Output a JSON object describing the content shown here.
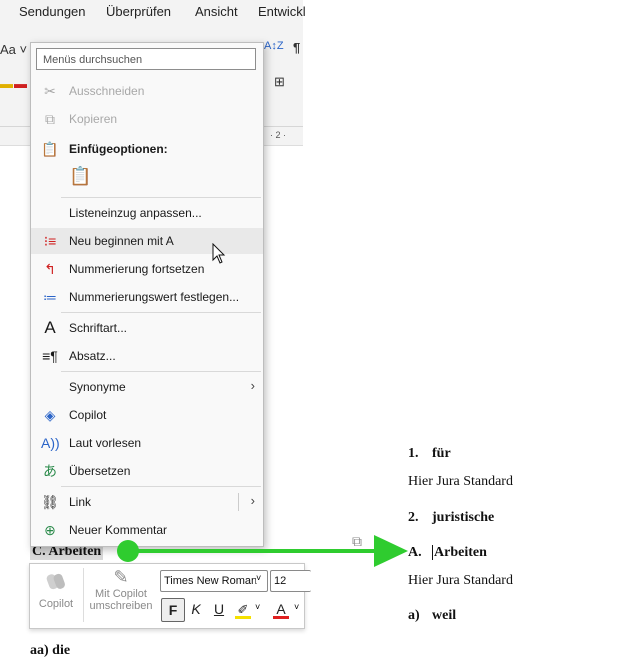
{
  "ribbon": {
    "tabs": [
      "Sendungen",
      "Überprüfen",
      "Ansicht",
      "Entwickl"
    ]
  },
  "document_left": {
    "heading": "C.  Arbeiten",
    "sub": "aa) die"
  },
  "context_menu": {
    "search_placeholder": "Menüs durchsuchen",
    "cut": "Ausschneiden",
    "copy": "Kopieren",
    "paste_header": "Einfügeoptionen:",
    "adjust_indent": "Listeneinzug anpassen...",
    "restart_at": "Neu beginnen mit A",
    "continue_numbering": "Nummerierung fortsetzen",
    "set_value": "Nummerierungswert festlegen...",
    "font": "Schriftart...",
    "paragraph": "Absatz...",
    "synonyms": "Synonyme",
    "copilot": "Copilot",
    "read_aloud": "Laut vorlesen",
    "translate": "Übersetzen",
    "link": "Link",
    "new_comment": "Neuer Kommentar"
  },
  "mini_toolbar": {
    "copilot": "Copilot",
    "rewrite_line1": "Mit Copilot",
    "rewrite_line2": "umschreiben",
    "font_name": "Times New Roman",
    "font_size": "12",
    "bold": "F",
    "italic": "K",
    "underline": "U",
    "highlight_color": "#f5e100",
    "font_color": "#e02020"
  },
  "arrow_color": "#2fcc2f",
  "document_right": {
    "item1_num": "1.",
    "item1_text": "für",
    "body1": "Hier Jura Standard",
    "item2_num": "2.",
    "item2_text": "juristische",
    "itemA_num": "A.",
    "itemA_text": "Arbeiten",
    "body2": "Hier Jura Standard",
    "itema_num": "a)",
    "itema_text": "weil"
  }
}
